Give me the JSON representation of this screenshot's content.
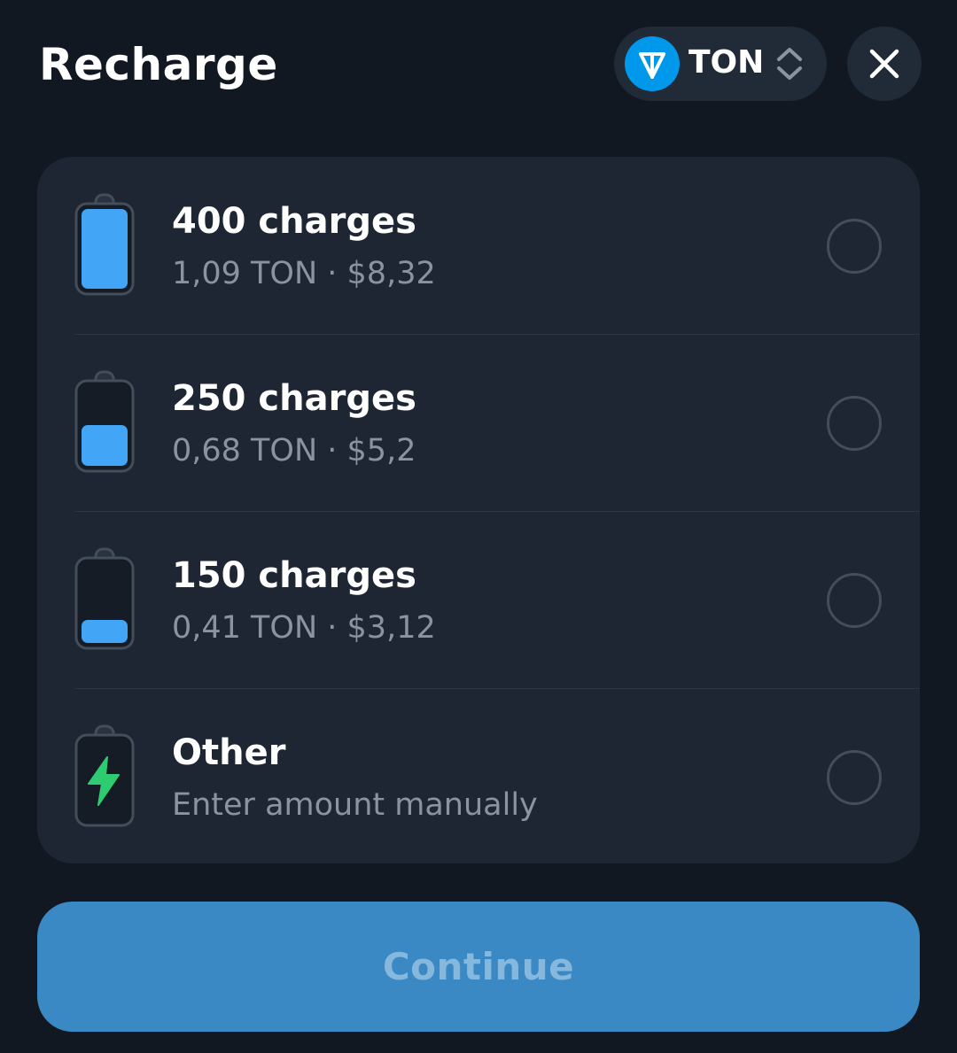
{
  "header": {
    "title": "Recharge",
    "currency": {
      "label": "TON",
      "icon": "ton-logo-icon",
      "switch_icon": "chevron-up-down-icon"
    },
    "close_icon": "close-icon"
  },
  "options": [
    {
      "title": "400 charges",
      "subtitle": "1,09 TON · $8,32",
      "battery_level": 1.0,
      "icon": "battery-full-icon",
      "selected": false
    },
    {
      "title": "250 charges",
      "subtitle": "0,68 TON · $5,2",
      "battery_level": 0.5,
      "icon": "battery-half-icon",
      "selected": false
    },
    {
      "title": "150 charges",
      "subtitle": "0,41 TON · $3,12",
      "battery_level": 0.25,
      "icon": "battery-low-icon",
      "selected": false
    },
    {
      "title": "Other",
      "subtitle": "Enter amount manually",
      "icon": "battery-charging-icon",
      "selected": false
    }
  ],
  "continue_label": "Continue",
  "colors": {
    "background": "#121822",
    "card": "#1f2633",
    "accent": "#42a5f5",
    "bolt": "#2ecc71",
    "button": "#3a89c4",
    "button_text": "#86b7dc",
    "ton_brand": "#0098ea"
  }
}
